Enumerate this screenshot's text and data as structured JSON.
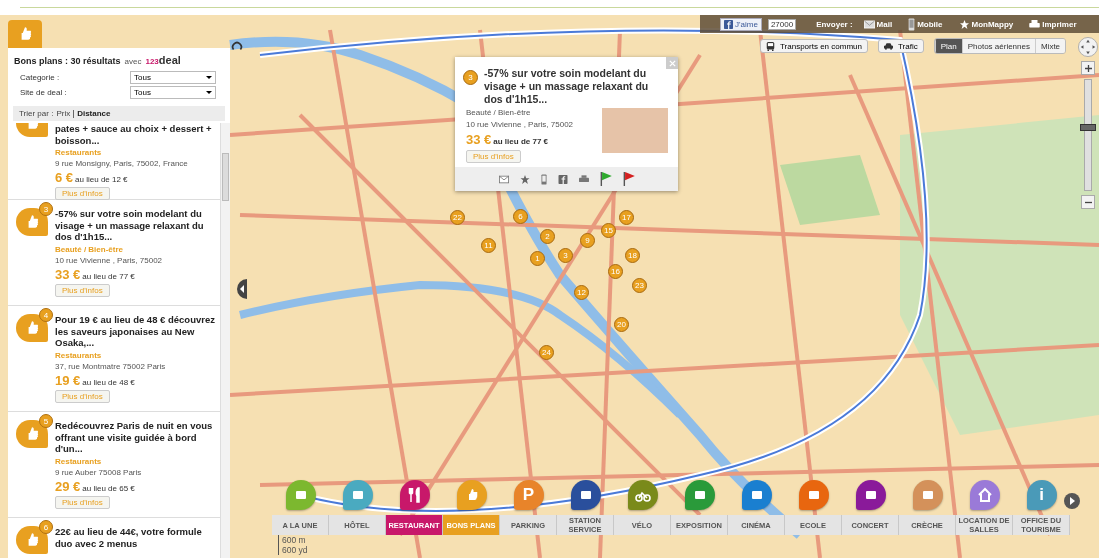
{
  "header_bar": {
    "like_label": "J'aime",
    "like_count": "27000",
    "send_label": "Envoyer :",
    "actions": [
      {
        "kind": "mail",
        "label": "Mail"
      },
      {
        "kind": "mobile",
        "label": "Mobile"
      },
      {
        "kind": "star",
        "label": "MonMappy"
      },
      {
        "kind": "print",
        "label": "Imprimer"
      }
    ]
  },
  "map_controls": {
    "layers": [
      {
        "kind": "bus",
        "label": "Transports en commun"
      },
      {
        "kind": "car",
        "label": "Trafic"
      }
    ],
    "views": [
      {
        "label": "Plan",
        "selected": true
      },
      {
        "label": "Photos aériennes",
        "selected": false
      },
      {
        "label": "Mixte",
        "selected": false
      }
    ],
    "zoom": {
      "level": 0.57
    }
  },
  "sidebar": {
    "title": "Bons plans : 30 résultats",
    "with_label": "avec",
    "partner": {
      "prefix": "123",
      "name": "deal"
    },
    "filters": [
      {
        "label": "Categorie :",
        "value": "Tous"
      },
      {
        "label": "Site de deal :",
        "value": "Tous"
      }
    ],
    "sort": {
      "label": "Trier par :",
      "options": [
        {
          "label": "Prix",
          "selected": false
        },
        {
          "label": "Distance",
          "selected": true
        }
      ]
    },
    "deals": [
      {
        "title": "pates + sauce au choix + dessert + boisson...",
        "category": "Restaurants",
        "address": "9 rue Monsigny, Paris, 75002, France",
        "price": "6 €",
        "old_price": "au lieu de 12 €",
        "button": "Plus d'infos"
      },
      {
        "badge": "3",
        "title": "-57% sur votre soin modelant du visage + un massage relaxant du dos d'1h15...",
        "category": "Beauté / Bien-être",
        "address": "10 rue Vivienne , Paris, 75002",
        "price": "33 €",
        "old_price": "au lieu de 77 €",
        "button": "Plus d'infos"
      },
      {
        "badge": "4",
        "title": "Pour 19 € au lieu de 48 € découvrez les saveurs japonaises au New Osaka,...",
        "category": "Restaurants",
        "address": "37, rue Montmatre 75002 Paris",
        "price": "19 €",
        "old_price": "au lieu de 48 €",
        "button": "Plus d'infos"
      },
      {
        "badge": "5",
        "title": "Redécouvrez Paris de nuit en vous offrant une visite guidée à bord d'un...",
        "category": "Restaurants",
        "address": "9 rue Auber 75008 Paris",
        "price": "29 €",
        "old_price": "au lieu de 65 €",
        "button": "Plus d'infos"
      },
      {
        "badge": "6",
        "title": "22€ au lieu de 44€, votre formule duo avec 2 menus"
      }
    ]
  },
  "map": {
    "pins": [
      "22",
      "6",
      "11",
      "2",
      "1",
      "3",
      "9",
      "15",
      "17",
      "18",
      "16",
      "23",
      "12",
      "20",
      "24"
    ],
    "scale": [
      "600 m",
      "600 yd"
    ]
  },
  "popup": {
    "badge": "3",
    "title": "-57% sur votre soin modelant du visage + un massage relaxant du dos d'1h15...",
    "category": "Beauté / Bien-être",
    "address": "10 rue Vivienne , Paris, 75002",
    "price": "33 €",
    "old_price": "au lieu de 77 €",
    "button": "Plus d'infos",
    "actions": [
      {
        "kind": "mail"
      },
      {
        "kind": "star"
      },
      {
        "kind": "mobile"
      },
      {
        "kind": "facebook"
      },
      {
        "kind": "print"
      },
      {
        "kind": "flag",
        "color": "#2eaa2e"
      },
      {
        "kind": "flag",
        "color": "#d42020"
      }
    ]
  },
  "categories": [
    {
      "kind": "news",
      "label": "A LA UNE",
      "color": "#7cb82f",
      "selected": false
    },
    {
      "kind": "hotel",
      "label": "HÔTEL",
      "color": "#4aaac0",
      "selected": false
    },
    {
      "kind": "restaurant",
      "label": "RESTAURANT",
      "color": "#c8186a",
      "selected": true
    },
    {
      "kind": "deal",
      "label": "BONS PLANS",
      "color": "#e8a020",
      "selected": true
    },
    {
      "kind": "letter",
      "glyph": "P",
      "label": "PARKING",
      "color": "#e8842a",
      "selected": false
    },
    {
      "kind": "fuel",
      "label": "STATION SERVICE",
      "color": "#2a4f9c",
      "selected": false
    },
    {
      "kind": "bike",
      "label": "VÉLO",
      "color": "#7a8a1a",
      "selected": false
    },
    {
      "kind": "museum",
      "label": "EXPOSITION",
      "color": "#2a9a3a",
      "selected": false
    },
    {
      "kind": "cinema",
      "label": "CINÉMA",
      "color": "#1a7fd0",
      "selected": false
    },
    {
      "kind": "school",
      "label": "ECOLE",
      "color": "#e8660f",
      "selected": false
    },
    {
      "kind": "mic",
      "label": "CONCERT",
      "color": "#8a1a9a",
      "selected": false
    },
    {
      "kind": "baby",
      "label": "CRÈCHE",
      "color": "#d4915a",
      "selected": false
    },
    {
      "kind": "house",
      "label": "LOCATION DE SALLES",
      "color": "#9a7ad8",
      "selected": false
    },
    {
      "kind": "letter",
      "glyph": "i",
      "label": "OFFICE DU TOURISME",
      "color": "#4a9ab8",
      "selected": false
    }
  ]
}
